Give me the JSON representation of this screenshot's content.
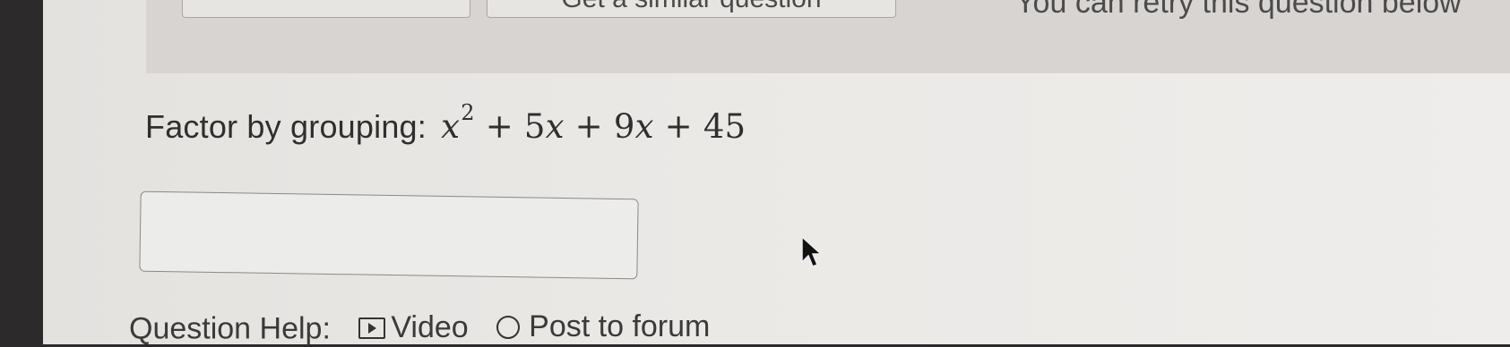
{
  "header": {
    "left_button_label": "",
    "similar_button_label": "Get a similar question",
    "retry_text": "You can retry this question below"
  },
  "question": {
    "prompt": "Factor by grouping:",
    "expression": {
      "var": "x",
      "exp": "2",
      "t1_op": "+",
      "t1_coef": "5",
      "t1_var": "x",
      "t2_op": "+",
      "t2_coef": "9",
      "t2_var": "x",
      "t3_op": "+",
      "t3_const": "45"
    }
  },
  "answer": {
    "value": "",
    "placeholder": ""
  },
  "help": {
    "label": "Question Help:",
    "video_label": "Video",
    "forum_label": "Post to forum"
  }
}
